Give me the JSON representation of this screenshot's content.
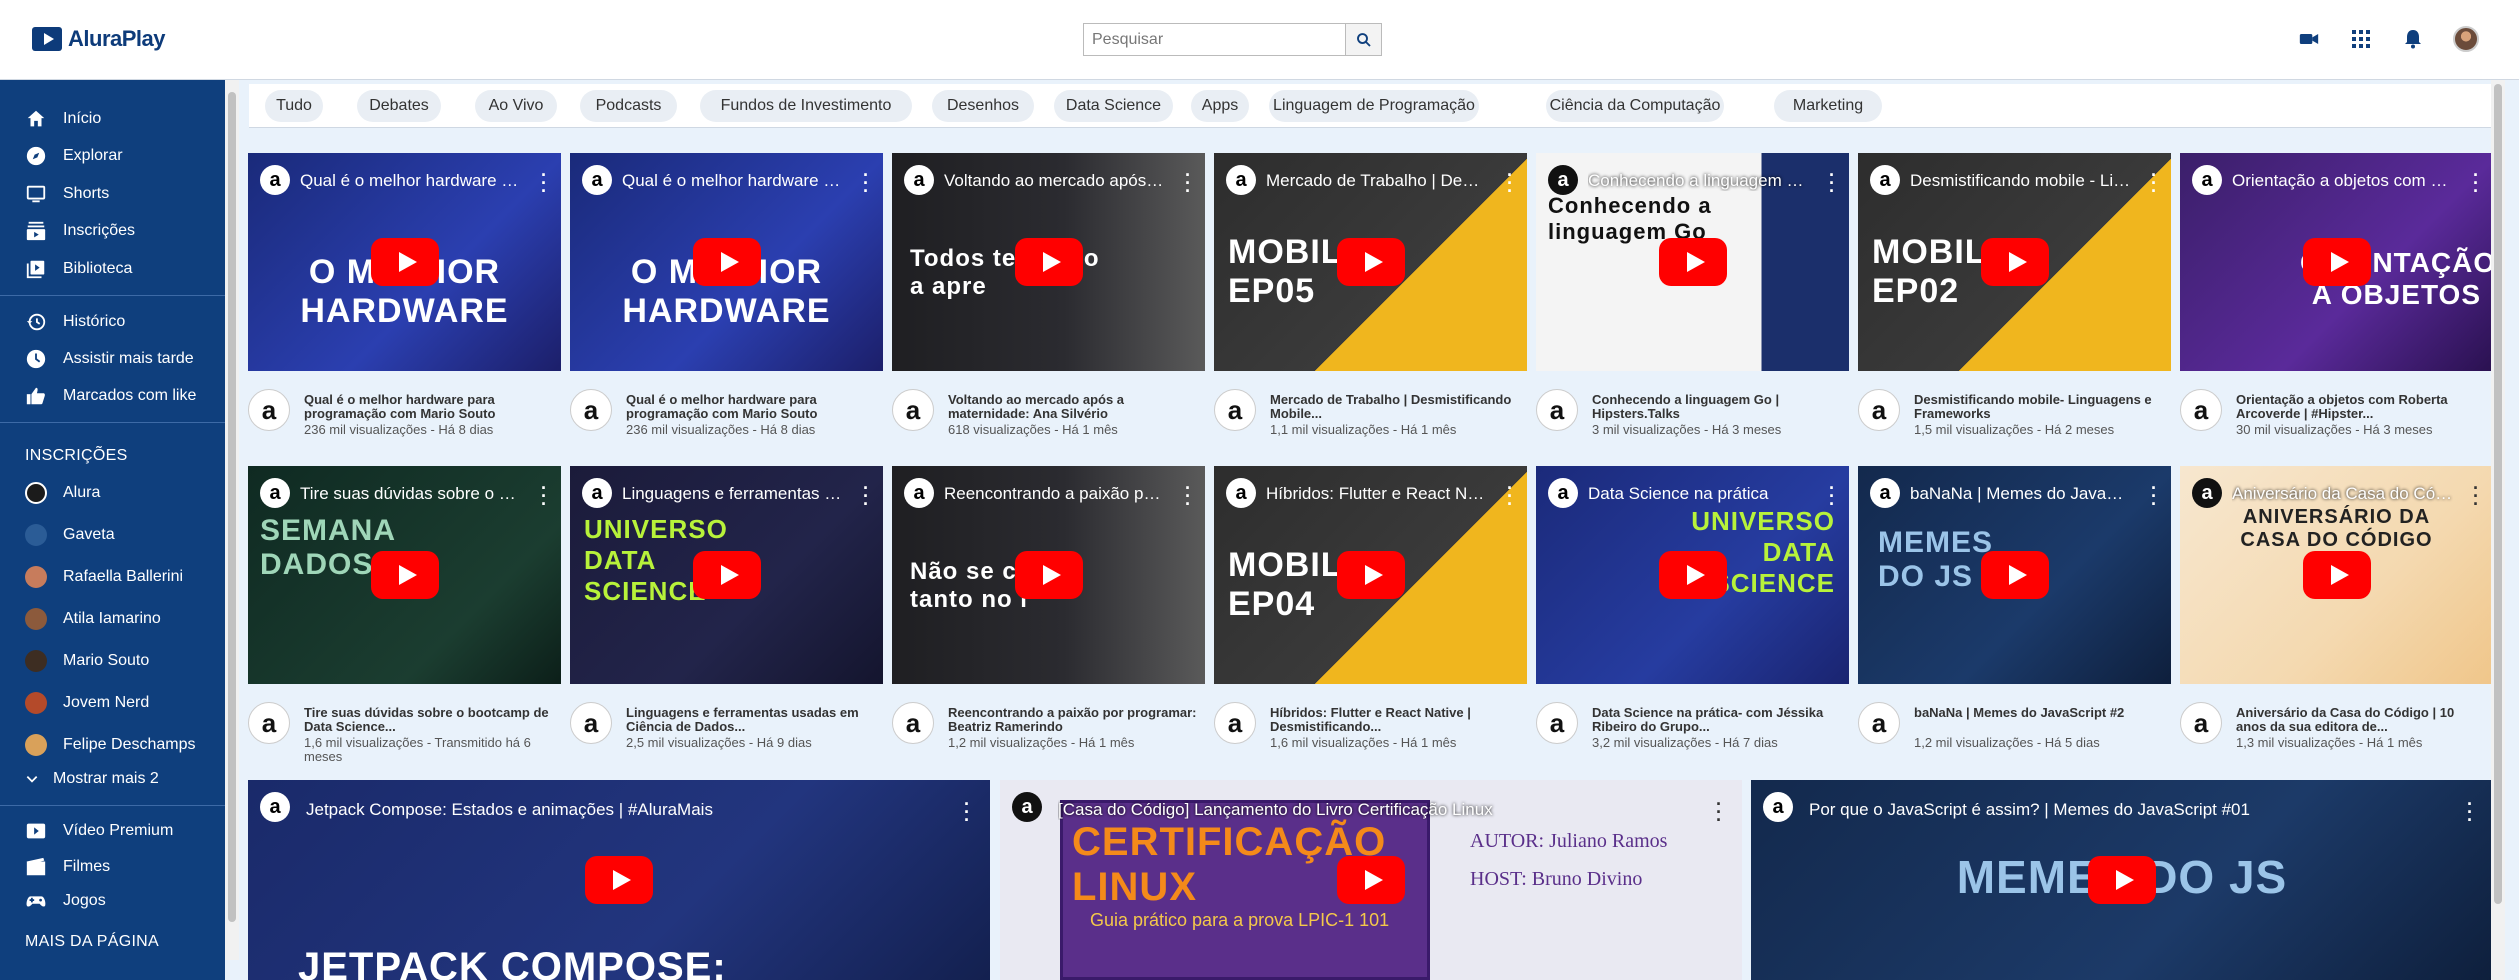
{
  "header": {
    "logo_text": "AluraPlay",
    "search_placeholder": "Pesquisar"
  },
  "sidebar": {
    "main": [
      {
        "label": "Início",
        "icon": "home-icon"
      },
      {
        "label": "Explorar",
        "icon": "compass-icon"
      },
      {
        "label": "Shorts",
        "icon": "shorts-icon"
      },
      {
        "label": "Inscrições",
        "icon": "subscriptions-icon"
      },
      {
        "label": "Biblioteca",
        "icon": "library-icon"
      }
    ],
    "secondary": [
      {
        "label": "Histórico",
        "icon": "history-icon"
      },
      {
        "label": "Assistir mais tarde",
        "icon": "watch-later-icon"
      },
      {
        "label": "Marcados com like",
        "icon": "like-icon"
      }
    ],
    "subscriptions_heading": "INSCRIÇÕES",
    "subscriptions": [
      {
        "label": "Alura",
        "color": "#1b1b1b"
      },
      {
        "label": "Gaveta",
        "color": "#2b5c96"
      },
      {
        "label": "Rafaella Ballerini",
        "color": "#c77c5c"
      },
      {
        "label": "Atila Iamarino",
        "color": "#8c5a3c"
      },
      {
        "label": "Mario Souto",
        "color": "#3d2d22"
      },
      {
        "label": "Jovem Nerd",
        "color": "#b44a2a"
      },
      {
        "label": "Felipe Deschamps",
        "color": "#d9a15a"
      }
    ],
    "show_more": "Mostrar mais 2",
    "extra": [
      {
        "label": "Vídeo Premium",
        "icon": "premium-icon"
      },
      {
        "label": "Filmes",
        "icon": "movies-icon"
      },
      {
        "label": "Jogos",
        "icon": "games-icon"
      }
    ],
    "more_heading": "MAIS DA PÁGINA"
  },
  "chips": [
    "Tudo",
    "Debates",
    "Ao Vivo",
    "Podcasts",
    "Fundos de Investimento",
    "Desenhos",
    "Data Science",
    "Apps",
    "Linguagem de Programação",
    "Ciência da Computação",
    "Marketing"
  ],
  "videos": [
    {
      "thumb_title": "Qual é o melhor hardware para programação com Mario Souto",
      "title": "Qual é o melhor hardware para programação com Mario Souto",
      "stats": "236 mil visualizações - Há 8 dias",
      "big": "O MELHOR HARDWARE"
    },
    {
      "thumb_title": "Qual é o melhor hardware para programação com Mario Souto",
      "title": "Qual é o melhor hardware para programação com Mario Souto",
      "stats": "236 mil visualizações - Há 8 dias",
      "big": "O MELHOR HARDWARE"
    },
    {
      "thumb_title": "Voltando ao mercado após a maternidade",
      "title": "Voltando ao mercado após a maternidade: Ana Silvério",
      "stats": "618 visualizações - Há 1 mês",
      "big": "Todos tem algo a apre"
    },
    {
      "thumb_title": "Mercado de Trabalho | Desmistificando Mobile",
      "title": "Mercado de Trabalho | Desmistificando Mobile...",
      "stats": "1,1 mil visualizações - Há 1 mês",
      "big": "MOBILE EP05"
    },
    {
      "thumb_title": "Conhecendo a linguagem Go | Hipsters.Talks",
      "title": "Conhecendo a linguagem Go | Hipsters.Talks",
      "stats": "3 mil visualizações - Há 3 meses",
      "big": "Conhecendo a linguagem Go"
    },
    {
      "thumb_title": "Desmistificando mobile - Linguagens e Frameworks",
      "title": "Desmistificando mobile- Linguagens e Frameworks",
      "stats": "1,5 mil visualizações - Há 2 meses",
      "big": "MOBILE EP02"
    },
    {
      "thumb_title": "Orientação a objetos com Roberta Arcoverde",
      "title": "Orientação a objetos com Roberta Arcoverde | #Hipster...",
      "stats": "30 mil visualizações - Há 3 meses",
      "big": "ORIENTAÇÃO A OBJETOS"
    },
    {
      "thumb_title": "Tire suas dúvidas sobre o bootcamp",
      "title": "Tire suas dúvidas sobre o bootcamp de Data Science...",
      "stats": "1,6 mil visualizações - Transmitido há 6 meses",
      "big": "SEMANA DADOS"
    },
    {
      "thumb_title": "Linguagens e ferramentas usadas em Ciência de Dados",
      "title": "Linguagens e ferramentas usadas em Ciência de Dados...",
      "stats": "2,5 mil visualizações - Há 9 dias",
      "big": "UNIVERSO DATA SCIENCE"
    },
    {
      "thumb_title": "Reencontrando a paixão por programar",
      "title": "Reencontrando a paixão por programar: Beatriz Ramerindo",
      "stats": "1,2 mil visualizações - Há 1 mês",
      "big": "Não se co tanto no i"
    },
    {
      "thumb_title": "Híbridos: Flutter e React Native",
      "title": "Híbridos: Flutter e React Native | Desmistificando...",
      "stats": "1,6 mil visualizações - Há 1 mês",
      "big": "MOBILE EP04"
    },
    {
      "thumb_title": "Data Science na prática",
      "title": "Data Science na prática- com Jéssika Ribeiro do Grupo...",
      "stats": "3,2 mil visualizações - Há 7 dias",
      "big": "UNIVERSO DATA SCIENCE"
    },
    {
      "thumb_title": "baNaNa | Memes do JavaScript",
      "title": "baNaNa | Memes do JavaScript #2",
      "stats": "1,2 mil visualizações - Há 5 dias",
      "big": "MEMES DO JS"
    },
    {
      "thumb_title": "Aniversário da Casa do Código",
      "title": "Aniversário da Casa do Código | 10 anos da sua editora de...",
      "stats": "1,3 mil visualizações - Há 1 mês",
      "big": "ANIVERSÁRIO DA CASA DO CÓDIGO"
    }
  ],
  "wide_videos": [
    {
      "thumb_title": "Jetpack Compose: Estados e animações | #AluraMais",
      "big": "JETPACK COMPOSE:"
    },
    {
      "thumb_title": "[Casa do Código] Lançamento do Livro Certificação Linux",
      "big": "CERTIFICAÇÃO LINUX",
      "author": "AUTOR: Juliano Ramos",
      "host": "HOST: Bruno Divino",
      "sub": "Guia prático para a prova LPIC-1 101"
    },
    {
      "thumb_title": "Por que o JavaScript é assim? | Memes do JavaScript #01",
      "big": "MEMES DO JS"
    }
  ]
}
